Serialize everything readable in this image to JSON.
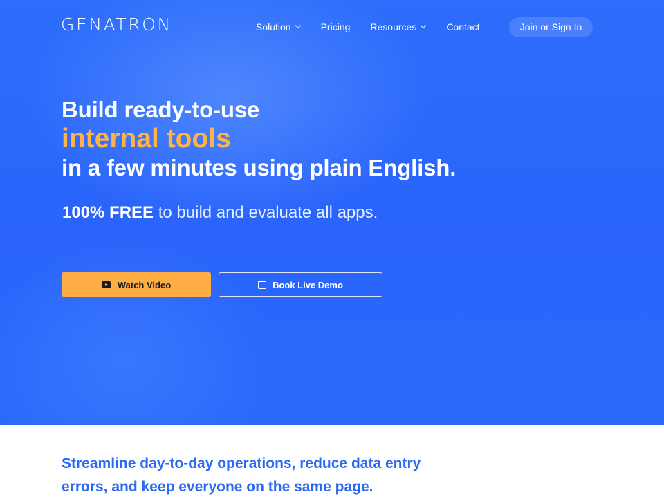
{
  "brand": {
    "logo_text": "GENATRON"
  },
  "nav": {
    "items": [
      {
        "label": "Solution",
        "has_dropdown": true
      },
      {
        "label": "Pricing",
        "has_dropdown": false
      },
      {
        "label": "Resources",
        "has_dropdown": true
      },
      {
        "label": "Contact",
        "has_dropdown": false
      }
    ],
    "signin_label": "Join or Sign In"
  },
  "hero": {
    "line1": "Build ready-to-use",
    "line2": "internal tools",
    "line3": "in a few minutes using plain English.",
    "sub_strong": "100% FREE",
    "sub_rest": " to build and evaluate all apps.",
    "buttons": {
      "watch_video": "Watch Video",
      "book_demo": "Book Live Demo"
    }
  },
  "section": {
    "tagline": "Streamline day-to-day operations, reduce data entry errors, and keep everyone on the same page."
  },
  "colors": {
    "hero_blue": "#2a64fb",
    "accent_orange": "#ffae45",
    "tagline_blue": "#2a6af2"
  },
  "icons": {
    "watch_video": "youtube-play-icon",
    "book_demo": "calendar-icon",
    "dropdown": "chevron-down-icon"
  }
}
